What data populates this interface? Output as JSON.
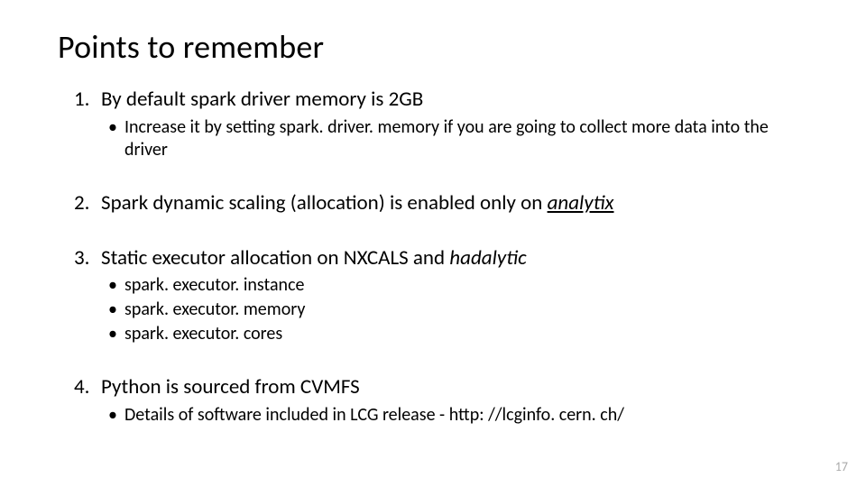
{
  "title": "Points to remember",
  "points": [
    {
      "text": "By default spark driver memory is 2GB",
      "sub": [
        "Increase it by setting spark. driver. memory if you are going to collect more data into the driver"
      ]
    },
    {
      "pre": "Spark dynamic scaling (allocation) is enabled only on ",
      "emph": "analytix",
      "emph_class": "italic underline",
      "sub": []
    },
    {
      "pre": "Static executor allocation on NXCALS and ",
      "emph": "hadalytic",
      "emph_class": "italic",
      "sub": [
        "spark. executor. instance",
        "spark. executor. memory",
        "spark. executor. cores"
      ]
    },
    {
      "text": "Python is sourced from CVMFS",
      "sub": [
        "Details of software included in LCG release - http: //lcginfo. cern. ch/"
      ]
    }
  ],
  "page_number": "17"
}
